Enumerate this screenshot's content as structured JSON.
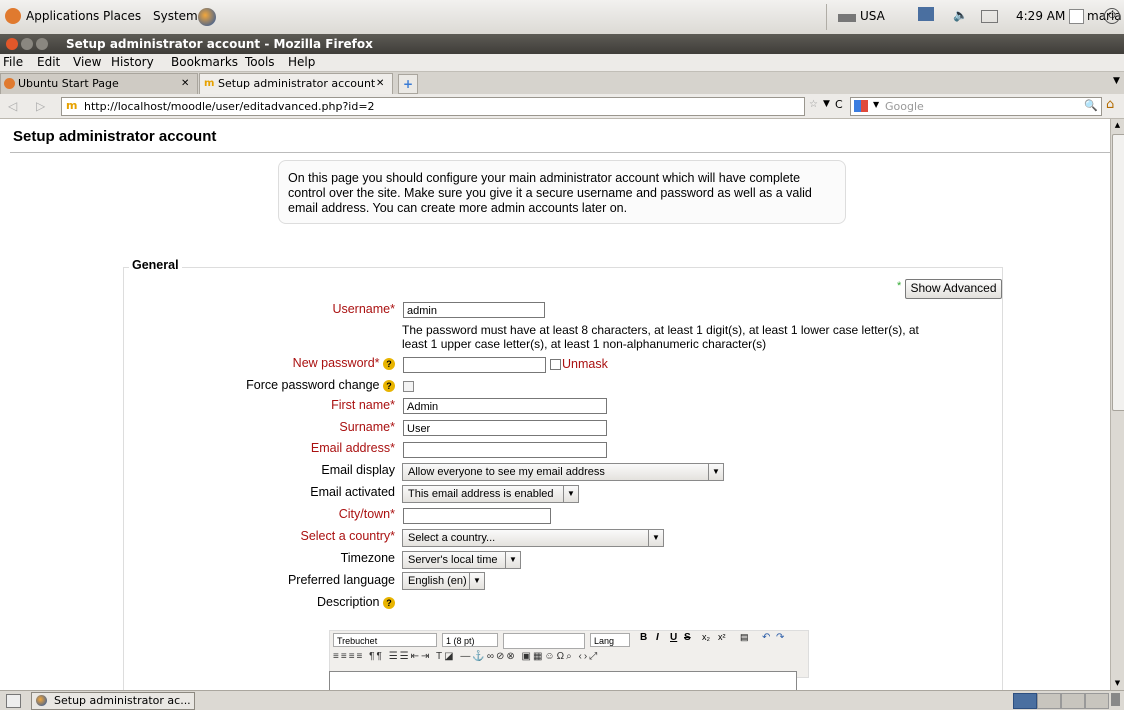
{
  "panel": {
    "menus": [
      "Applications",
      "Places",
      "System"
    ],
    "keyboard": "USA",
    "clock": "4:29 AM",
    "user": "maria"
  },
  "window": {
    "title": "Setup administrator account - Mozilla Firefox"
  },
  "menubar": [
    "File",
    "Edit",
    "View",
    "History",
    "Bookmarks",
    "Tools",
    "Help"
  ],
  "tabs": [
    "Ubuntu Start Page",
    "Setup administrator account"
  ],
  "nav": {
    "url": "http://localhost/moodle/user/editadvanced.php?id=2",
    "search_placeholder": "Google"
  },
  "page": {
    "heading": "Setup administrator account",
    "intro": "On this page you should configure your main administrator account which will have complete control over the site. Make sure you give it a secure username and password as well as a valid email address. You can create more admin accounts later on.",
    "section": "General",
    "show_advanced": "Show Advanced",
    "password_hint": "The password must have at least 8 characters, at least 1 digit(s), at least 1 lower case letter(s), at least 1 upper case letter(s), at least 1 non-alphanumeric character(s)",
    "fields": {
      "username": {
        "label": "Username",
        "value": "admin"
      },
      "new_password": {
        "label": "New password",
        "value": "",
        "unmask": "Unmask"
      },
      "force_change": {
        "label": "Force password change"
      },
      "first_name": {
        "label": "First name",
        "value": "Admin"
      },
      "surname": {
        "label": "Surname",
        "value": "User"
      },
      "email": {
        "label": "Email address",
        "value": ""
      },
      "email_display": {
        "label": "Email display",
        "value": "Allow everyone to see my email address"
      },
      "email_activated": {
        "label": "Email activated",
        "value": "This email address is enabled"
      },
      "city": {
        "label": "City/town",
        "value": ""
      },
      "country": {
        "label": "Select a country",
        "value": "Select a country..."
      },
      "timezone": {
        "label": "Timezone",
        "value": "Server's local time"
      },
      "language": {
        "label": "Preferred language",
        "value": "English (en)"
      },
      "description": {
        "label": "Description"
      }
    },
    "editor": {
      "font": "Trebuchet",
      "size": "1 (8 pt)",
      "lang": "Lang"
    }
  },
  "status": {
    "task": "Setup administrator ac..."
  },
  "colors": {
    "required": "#aa1111",
    "title_bar": "#4a4844"
  }
}
